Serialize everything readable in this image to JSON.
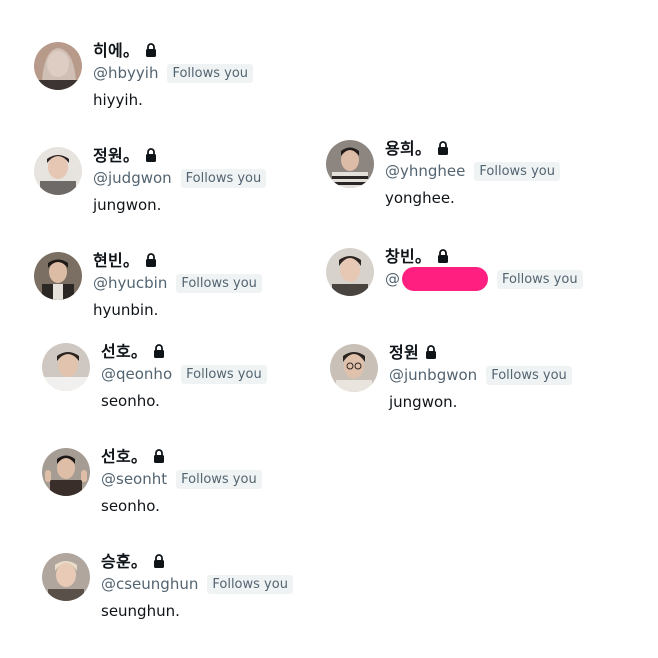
{
  "colors": {
    "text": "#0f1419",
    "secondary": "#536471",
    "badge_bg": "#eff3f4",
    "redaction": "#ff1f80"
  },
  "follows_label": "Follows you",
  "accounts": [
    {
      "name": "히에。",
      "handle": "@hbyyih",
      "bio": "hiyyih.",
      "locked": true,
      "follows_you": true
    },
    {
      "name": "정원。",
      "handle": "@judgwon",
      "bio": "jungwon.",
      "locked": true,
      "follows_you": true
    },
    {
      "name": "현빈。",
      "handle": "@hyucbin",
      "bio": "hyunbin.",
      "locked": true,
      "follows_you": true
    },
    {
      "name": "선호。",
      "handle": "@qeonho",
      "bio": "seonho.",
      "locked": true,
      "follows_you": true
    },
    {
      "name": "선호。",
      "handle": "@seonht",
      "bio": "seonho.",
      "locked": true,
      "follows_you": true
    },
    {
      "name": "승훈。",
      "handle": "@cseunghun",
      "bio": "seunghun.",
      "locked": true,
      "follows_you": true
    },
    {
      "name": "용희。",
      "handle": "@yhnghee",
      "bio": "yonghee.",
      "locked": true,
      "follows_you": true
    },
    {
      "name": "창빈。",
      "handle": "@",
      "bio": "",
      "locked": true,
      "follows_you": true
    },
    {
      "name": "정원",
      "handle": "@junbgwon",
      "bio": "jungwon.",
      "locked": true,
      "follows_you": true
    }
  ]
}
